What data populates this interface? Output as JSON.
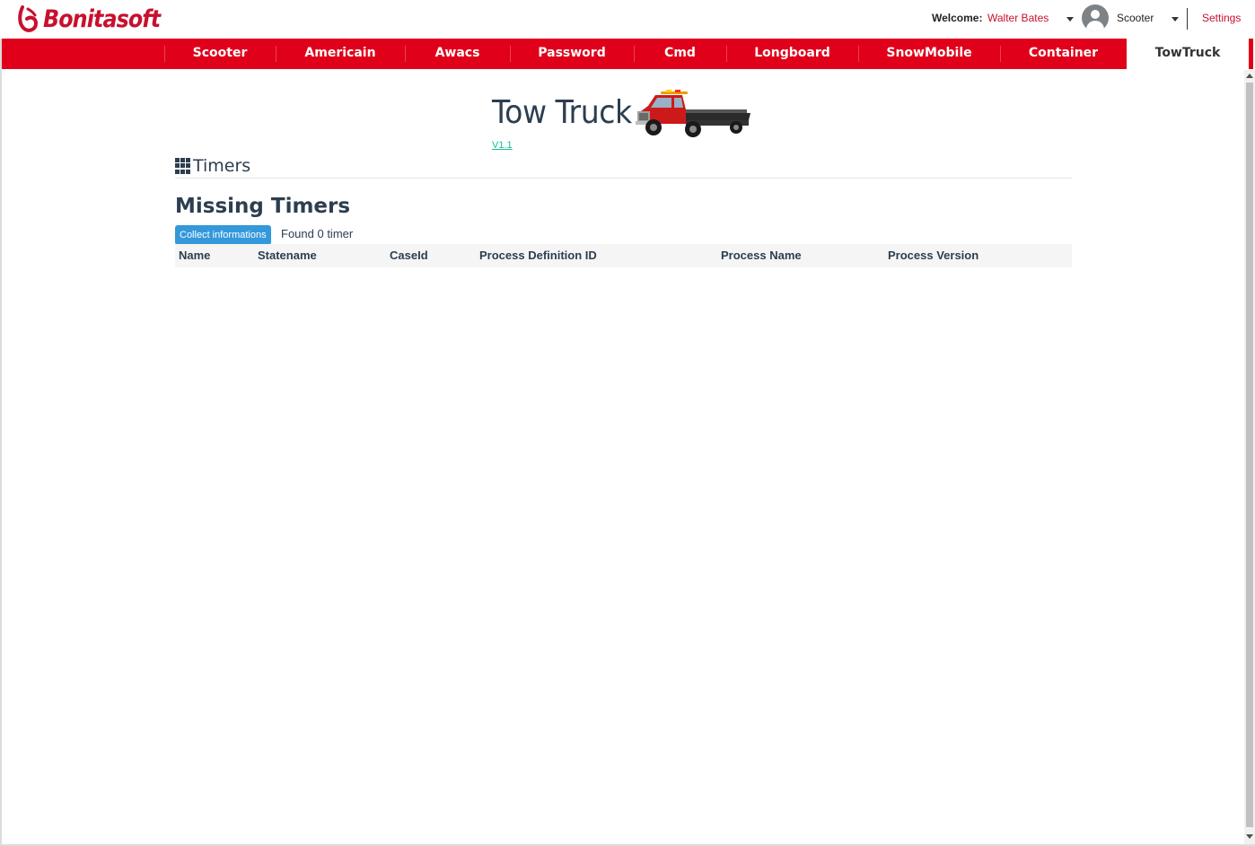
{
  "header": {
    "logo_text": "Bonitasoft",
    "welcome_label": "Welcome:",
    "user_name": "Walter Bates",
    "app_name": "Scooter",
    "settings_label": "Settings"
  },
  "nav": {
    "items": [
      {
        "label": "Scooter"
      },
      {
        "label": "Americain"
      },
      {
        "label": "Awacs"
      },
      {
        "label": "Password"
      },
      {
        "label": "Cmd"
      },
      {
        "label": "Longboard"
      },
      {
        "label": "SnowMobile"
      },
      {
        "label": "Container"
      },
      {
        "label": "TowTruck",
        "active": true
      }
    ]
  },
  "page": {
    "title": "Tow Truck",
    "version": "V1.1",
    "section_title": "Timers",
    "subheading": "Missing Timers",
    "collect_button": "Collect informations",
    "found_text": "Found 0 timer",
    "table": {
      "columns": [
        "Name",
        "Statename",
        "CaseId",
        "Process Definition ID",
        "Process Name",
        "Process Version"
      ],
      "rows": []
    }
  },
  "colors": {
    "brand_red": "#e0001a",
    "link_red": "#c8102e",
    "button_blue": "#3498db",
    "version_green": "#18bc9c",
    "text_dark": "#2c3e50"
  },
  "icons": {
    "logo": "bonita-logo-icon",
    "user": "user-avatar-icon",
    "section": "grid-icon",
    "truck": "tow-truck-image"
  }
}
